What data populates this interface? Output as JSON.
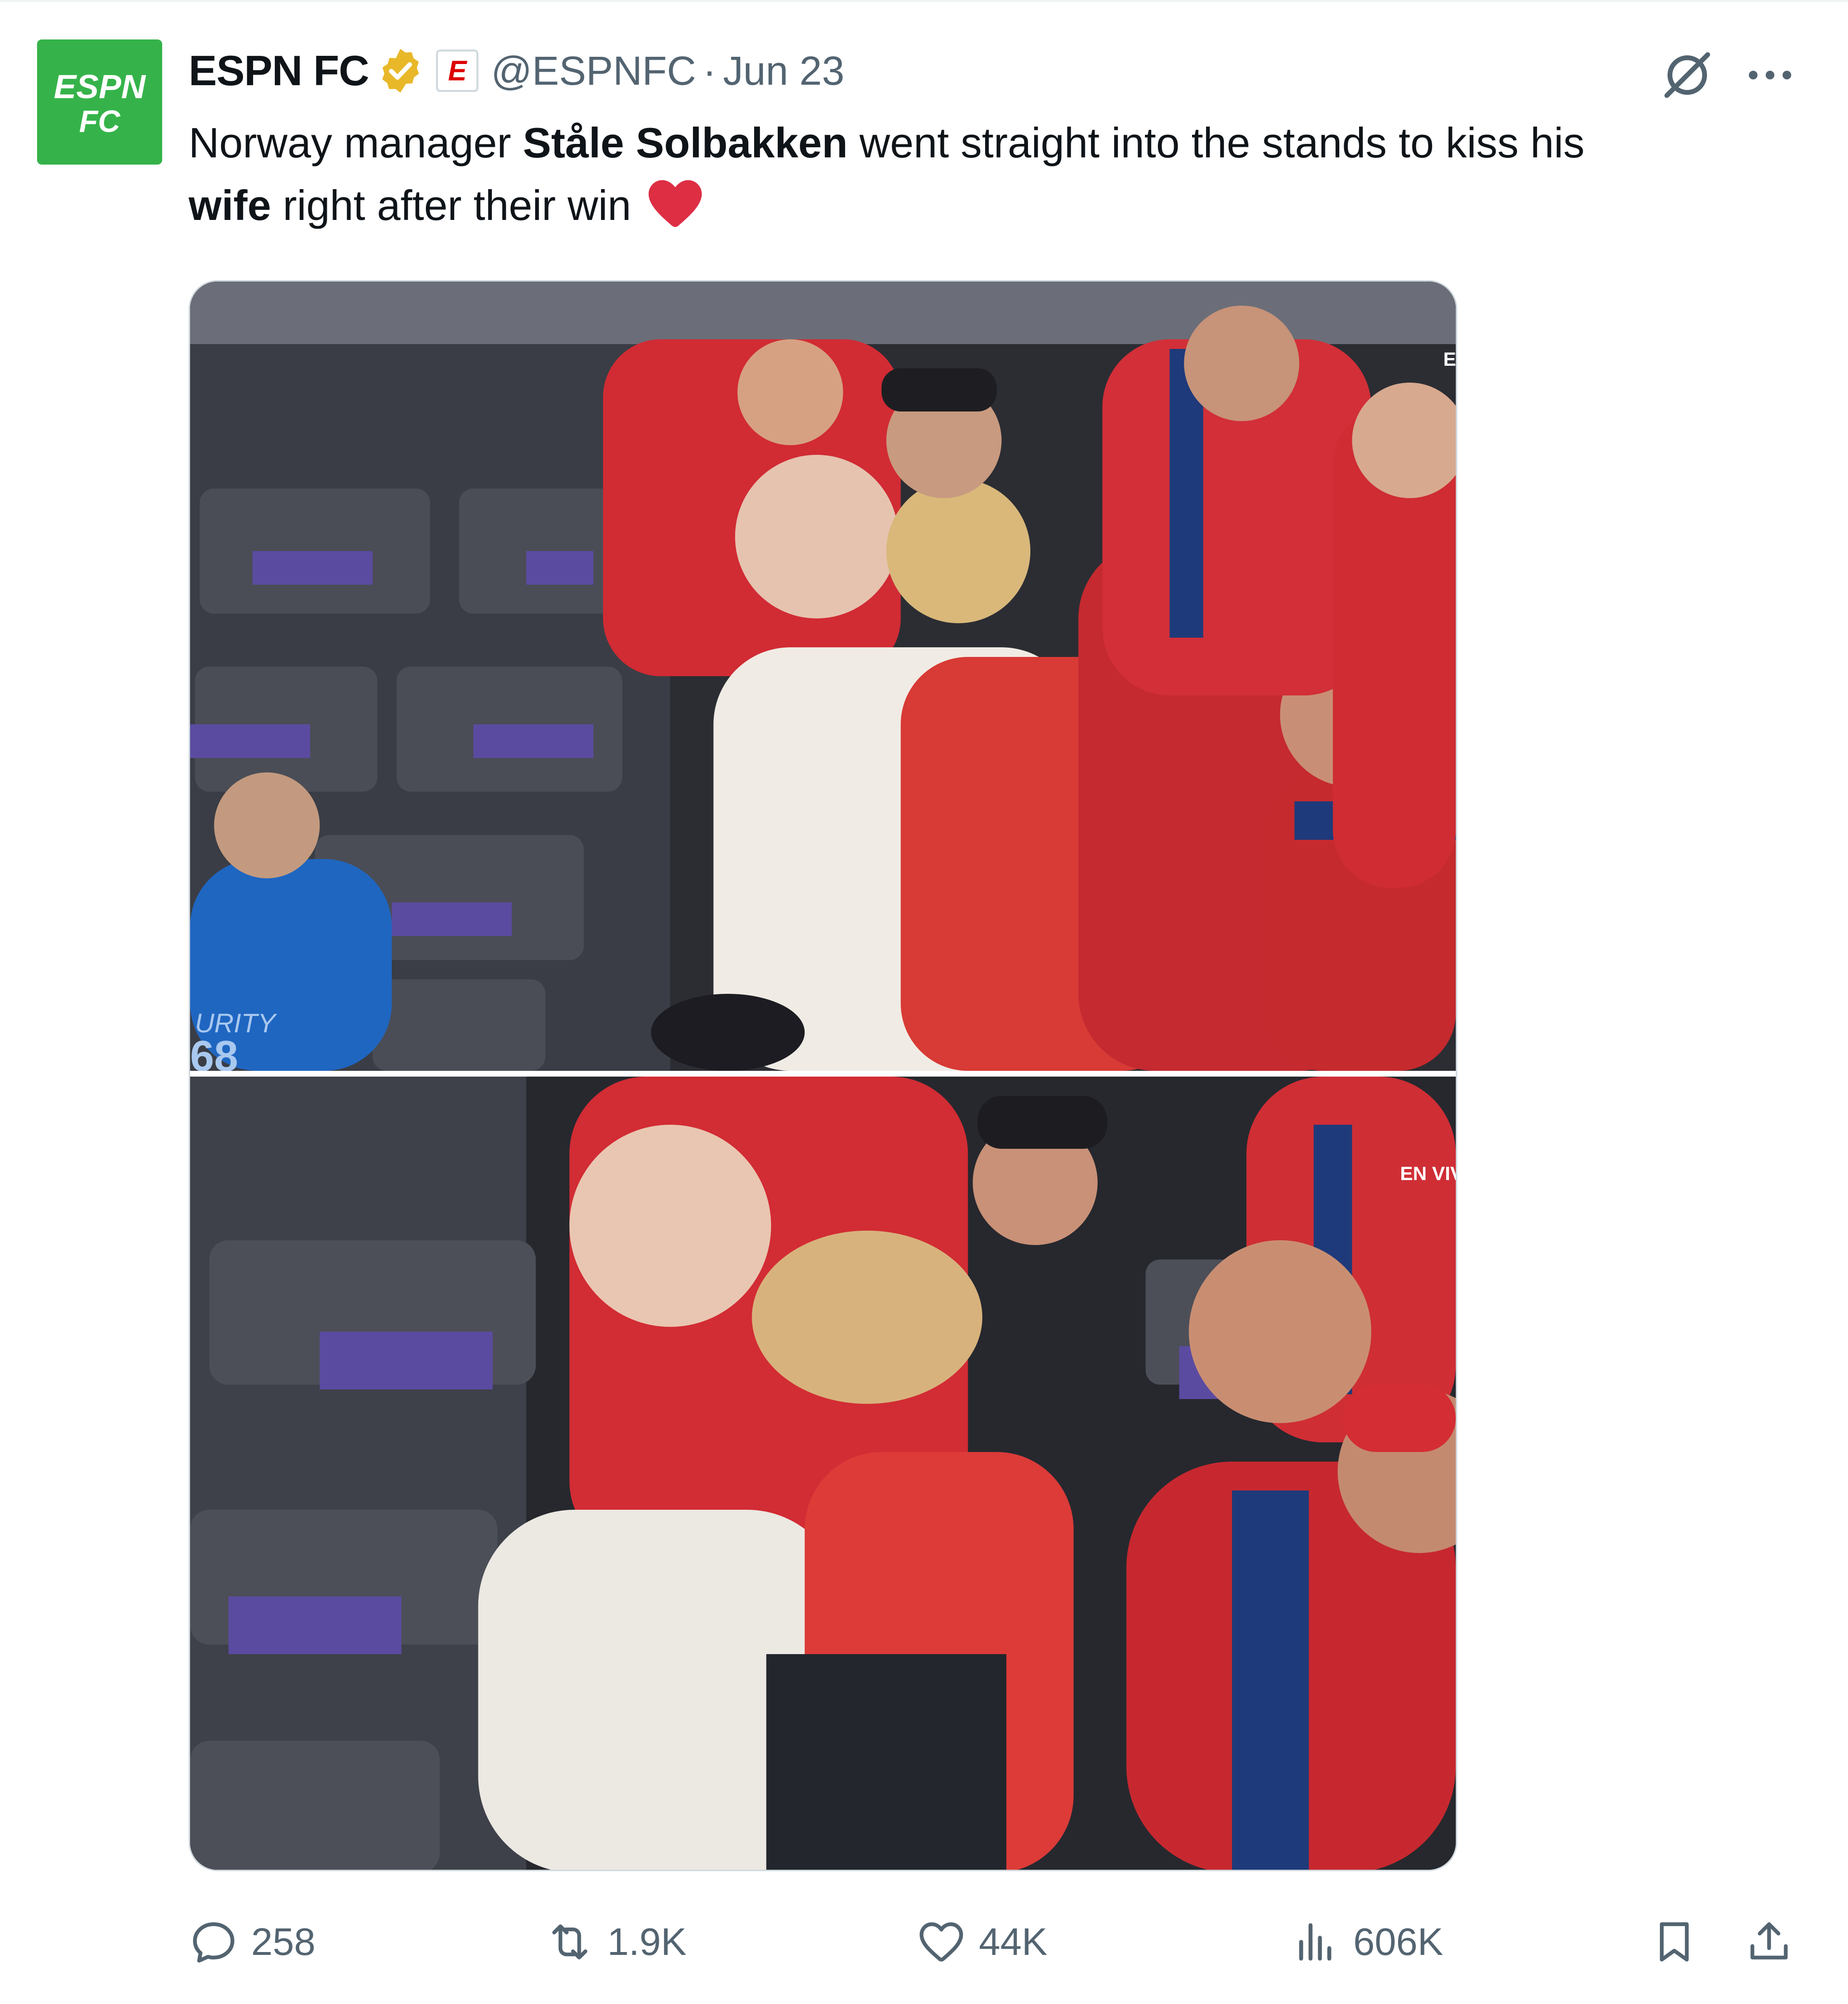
{
  "tweet": {
    "author": {
      "display_name": "ESPN FC",
      "handle": "@ESPNFC",
      "avatar_text_line1": "ESPN",
      "avatar_text_line2": "FC",
      "affiliate_badge": "E"
    },
    "separator": "·",
    "date": "Jun 23",
    "text": {
      "part1": "Norway manager ",
      "bold1": "Ståle Solbakken",
      "part2": " went straight into the stands to kiss his ",
      "bold2": "wife",
      "part3": " right after their win"
    },
    "media": {
      "photo1_overlay_tag": "E",
      "photo1_overlay_shirt": "URITY",
      "photo1_overlay_shirt2": "68",
      "photo2_overlay_tag": "EN VIV"
    },
    "actions": {
      "replies": "258",
      "reposts": "1.9K",
      "likes": "44K",
      "views": "606K"
    }
  },
  "icons": [
    "verified-badge-icon",
    "grok-icon",
    "more-icon",
    "heart-emoji-icon",
    "reply-icon",
    "repost-icon",
    "like-icon",
    "views-icon",
    "bookmark-icon",
    "share-icon"
  ],
  "colors": {
    "text": "#0f1419",
    "muted": "#536471",
    "verified_gold": "#e8b829",
    "espn_green": "#35b34a",
    "heart_red": "#e0245e"
  }
}
